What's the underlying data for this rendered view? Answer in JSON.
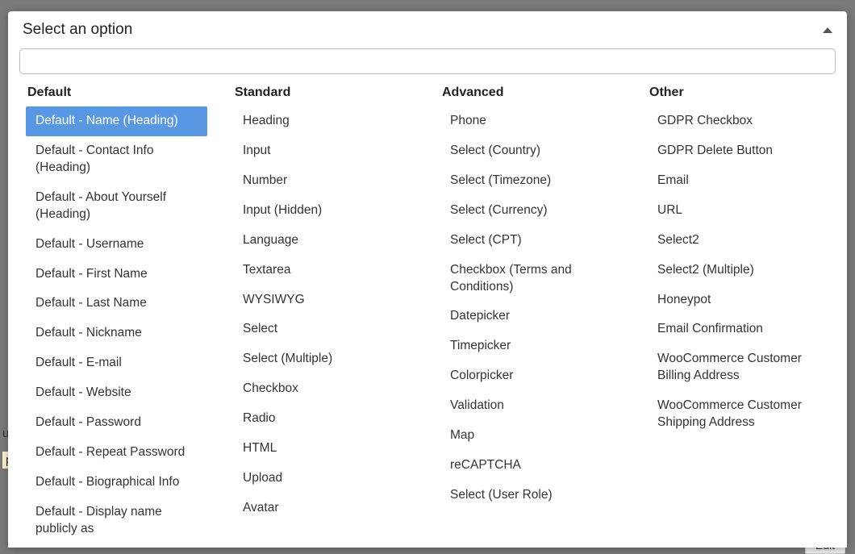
{
  "title": "Select an option",
  "search": {
    "value": "",
    "placeholder": ""
  },
  "bg": {
    "edit": "Edit"
  },
  "groups": [
    {
      "label": "Default",
      "items": [
        {
          "label": "Default - Name (Heading)",
          "selected": true
        },
        {
          "label": "Default - Contact Info (Heading)"
        },
        {
          "label": "Default - About Yourself (Heading)"
        },
        {
          "label": "Default - Username"
        },
        {
          "label": "Default - First Name"
        },
        {
          "label": "Default - Last Name"
        },
        {
          "label": "Default - Nickname"
        },
        {
          "label": "Default - E-mail"
        },
        {
          "label": "Default - Website"
        },
        {
          "label": "Default - Password"
        },
        {
          "label": "Default - Repeat Password"
        },
        {
          "label": "Default - Biographical Info"
        },
        {
          "label": "Default - Display name publicly as"
        }
      ]
    },
    {
      "label": "Standard",
      "items": [
        {
          "label": "Heading"
        },
        {
          "label": "Input"
        },
        {
          "label": "Number"
        },
        {
          "label": "Input (Hidden)"
        },
        {
          "label": "Language"
        },
        {
          "label": "Textarea"
        },
        {
          "label": "WYSIWYG"
        },
        {
          "label": "Select"
        },
        {
          "label": "Select (Multiple)"
        },
        {
          "label": "Checkbox"
        },
        {
          "label": "Radio"
        },
        {
          "label": "HTML"
        },
        {
          "label": "Upload"
        },
        {
          "label": "Avatar"
        }
      ]
    },
    {
      "label": "Advanced",
      "items": [
        {
          "label": "Phone"
        },
        {
          "label": "Select (Country)"
        },
        {
          "label": "Select (Timezone)"
        },
        {
          "label": "Select (Currency)"
        },
        {
          "label": "Select (CPT)"
        },
        {
          "label": "Checkbox (Terms and Conditions)"
        },
        {
          "label": "Datepicker"
        },
        {
          "label": "Timepicker"
        },
        {
          "label": "Colorpicker"
        },
        {
          "label": "Validation"
        },
        {
          "label": "Map"
        },
        {
          "label": "reCAPTCHA"
        },
        {
          "label": "Select (User Role)"
        }
      ]
    },
    {
      "label": "Other",
      "items": [
        {
          "label": "GDPR Checkbox"
        },
        {
          "label": "GDPR Delete Button"
        },
        {
          "label": "Email"
        },
        {
          "label": "URL"
        },
        {
          "label": "Select2"
        },
        {
          "label": "Select2 (Multiple)"
        },
        {
          "label": "Honeypot"
        },
        {
          "label": "Email Confirmation"
        },
        {
          "label": "WooCommerce Customer Billing Address"
        },
        {
          "label": "WooCommerce Customer Shipping Address"
        }
      ]
    }
  ]
}
